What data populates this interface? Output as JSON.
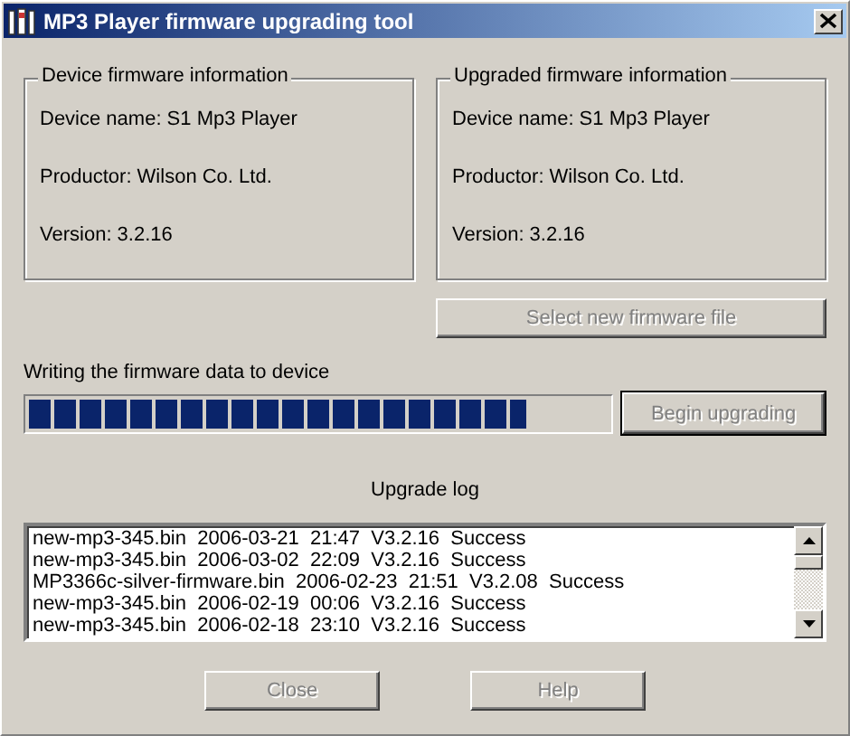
{
  "window": {
    "title": "MP3 Player firmware upgrading tool"
  },
  "device_info": {
    "title": "Device firmware information",
    "lines": [
      "Device name: S1 Mp3 Player",
      "Productor: Wilson Co. Ltd.",
      "Version: 3.2.16"
    ]
  },
  "upgraded_info": {
    "title": "Upgraded firmware information",
    "lines": [
      "Device name: S1 Mp3 Player",
      "Productor: Wilson Co. Ltd.",
      "Version: 3.2.16"
    ]
  },
  "select_button": {
    "label": "Select new firmware file",
    "disabled": true
  },
  "progress": {
    "label": "Writing the firmware data to device",
    "level": 0.86
  },
  "begin_button": {
    "label": "Begin upgrading",
    "disabled": true
  },
  "log": {
    "title": "Upgrade log",
    "entries": [
      "new-mp3-345.bin  2006-03-21  21:47  V3.2.16  Success",
      "new-mp3-345.bin  2006-03-02  22:09  V3.2.16  Success",
      "MP3366c-silver-firmware.bin  2006-02-23  21:51  V3.2.08  Success",
      "new-mp3-345.bin  2006-02-19  00:06  V3.2.16  Success",
      "new-mp3-345.bin  2006-02-18  23:10  V3.2.16  Success"
    ]
  },
  "buttons": [
    {
      "label": "Close",
      "disabled": true
    },
    {
      "label": "Help",
      "disabled": true
    }
  ]
}
